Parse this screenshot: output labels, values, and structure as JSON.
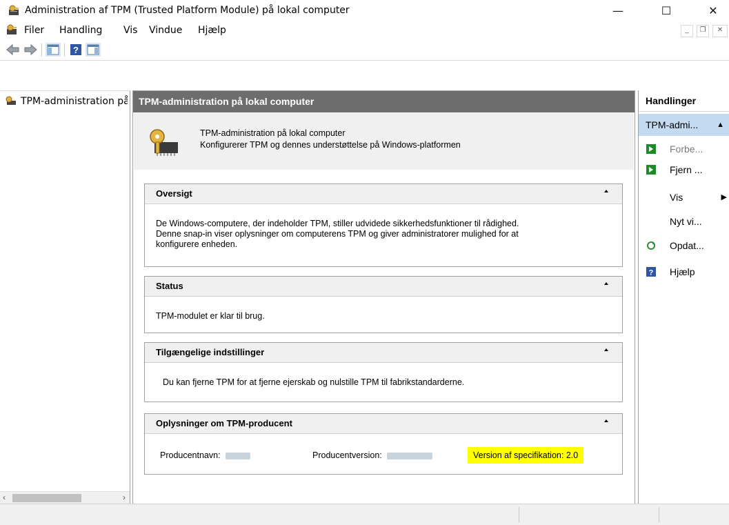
{
  "window": {
    "title": "Administration af TPM (Trusted Platform Module) på lokal computer",
    "minimize": "—",
    "maximize": "☐",
    "close": "✕"
  },
  "menu": {
    "items": [
      "Filer",
      "Handling",
      "Vis",
      "Vindue",
      "Hjælp"
    ]
  },
  "tree": {
    "root_label": "TPM-administration på lokal computer"
  },
  "center": {
    "header": "TPM-administration på lokal computer",
    "intro_title": "TPM-administration på lokal computer",
    "intro_desc": "Konfigurerer TPM og dennes understøttelse på Windows-platformen",
    "sections": {
      "overview": {
        "title": "Oversigt",
        "line1": "De Windows-computere, der indeholder TPM, stiller udvidede sikkerhedsfunktioner til rådighed.",
        "line2": "Denne snap-in viser oplysninger om computerens TPM og giver administratorer mulighed for at",
        "line3": "konfigurere enheden."
      },
      "status": {
        "title": "Status",
        "text": "TPM-modulet er klar til brug."
      },
      "settings": {
        "title": "Tilgængelige indstillinger",
        "text": "Du kan fjerne TPM for at fjerne ejerskab og nulstille TPM til fabrikstandarderne."
      },
      "manufacturer": {
        "title": "Oplysninger om TPM-producent",
        "name_label": "Producentnavn:",
        "version_label": "Producentversion:",
        "spec_label": "Version af specifikation:",
        "spec_value": "2.0"
      }
    }
  },
  "actions": {
    "header": "Handlinger",
    "subheader": "TPM-admi...",
    "items": [
      "Forbe...",
      "Fjern ...",
      "Vis",
      "Nyt vi...",
      "Opdat...",
      "Hjælp"
    ]
  },
  "colors": {
    "header_bg": "#6d6d6d",
    "selected_bg": "#c4daf0",
    "highlight": "#ffff00"
  }
}
